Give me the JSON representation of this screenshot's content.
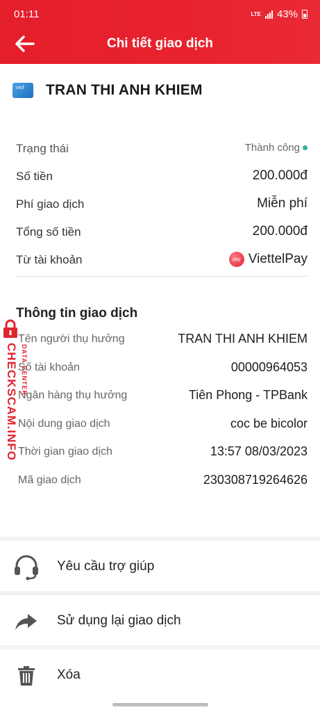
{
  "status_bar": {
    "time": "01:11",
    "network": "LTE",
    "battery": "43%"
  },
  "header": {
    "title": "Chi tiết giao dịch",
    "back_icon": "arrow-left-icon",
    "background": "#e41e2b"
  },
  "recipient": {
    "name": "TRAN THI ANH KHIEM",
    "icon_text": "vnđ"
  },
  "summary": {
    "status_label": "Trạng thái",
    "status_value": "Thành công",
    "status_color": "#2db39a",
    "amount_label": "Số tiền",
    "amount_value": "200.000đ",
    "fee_label": "Phí giao dịch",
    "fee_value": "Miễn phí",
    "total_label": "Tổng số tiền",
    "total_value": "200.000đ",
    "source_label": "Từ tài khoản",
    "source_value": "ViettelPay",
    "source_icon_text": "pay"
  },
  "info": {
    "title": "Thông tin giao dịch",
    "rows": [
      {
        "label": "Tên người thụ hưởng",
        "value": "TRAN THI ANH KHIEM"
      },
      {
        "label": "Số tài khoản",
        "value": "00000964053"
      },
      {
        "label": "Ngân hàng thụ hưởng",
        "value": "Tiên Phong - TPBank"
      },
      {
        "label": "Nội dung giao dịch",
        "value": "coc be bicolor"
      },
      {
        "label": "Thời gian giao dịch",
        "value": "13:57 08/03/2023"
      },
      {
        "label": "Mã giao dịch",
        "value": "230308719264626"
      }
    ]
  },
  "watermark": {
    "main": "CHECKSCAM.INFO",
    "sub": "DATA CENTER"
  },
  "actions": [
    {
      "label": "Yêu cầu trợ giúp",
      "icon": "headset-icon"
    },
    {
      "label": "Sử dụng lại giao dịch",
      "icon": "share-arrow-icon"
    },
    {
      "label": "Xóa",
      "icon": "trash-icon"
    }
  ]
}
